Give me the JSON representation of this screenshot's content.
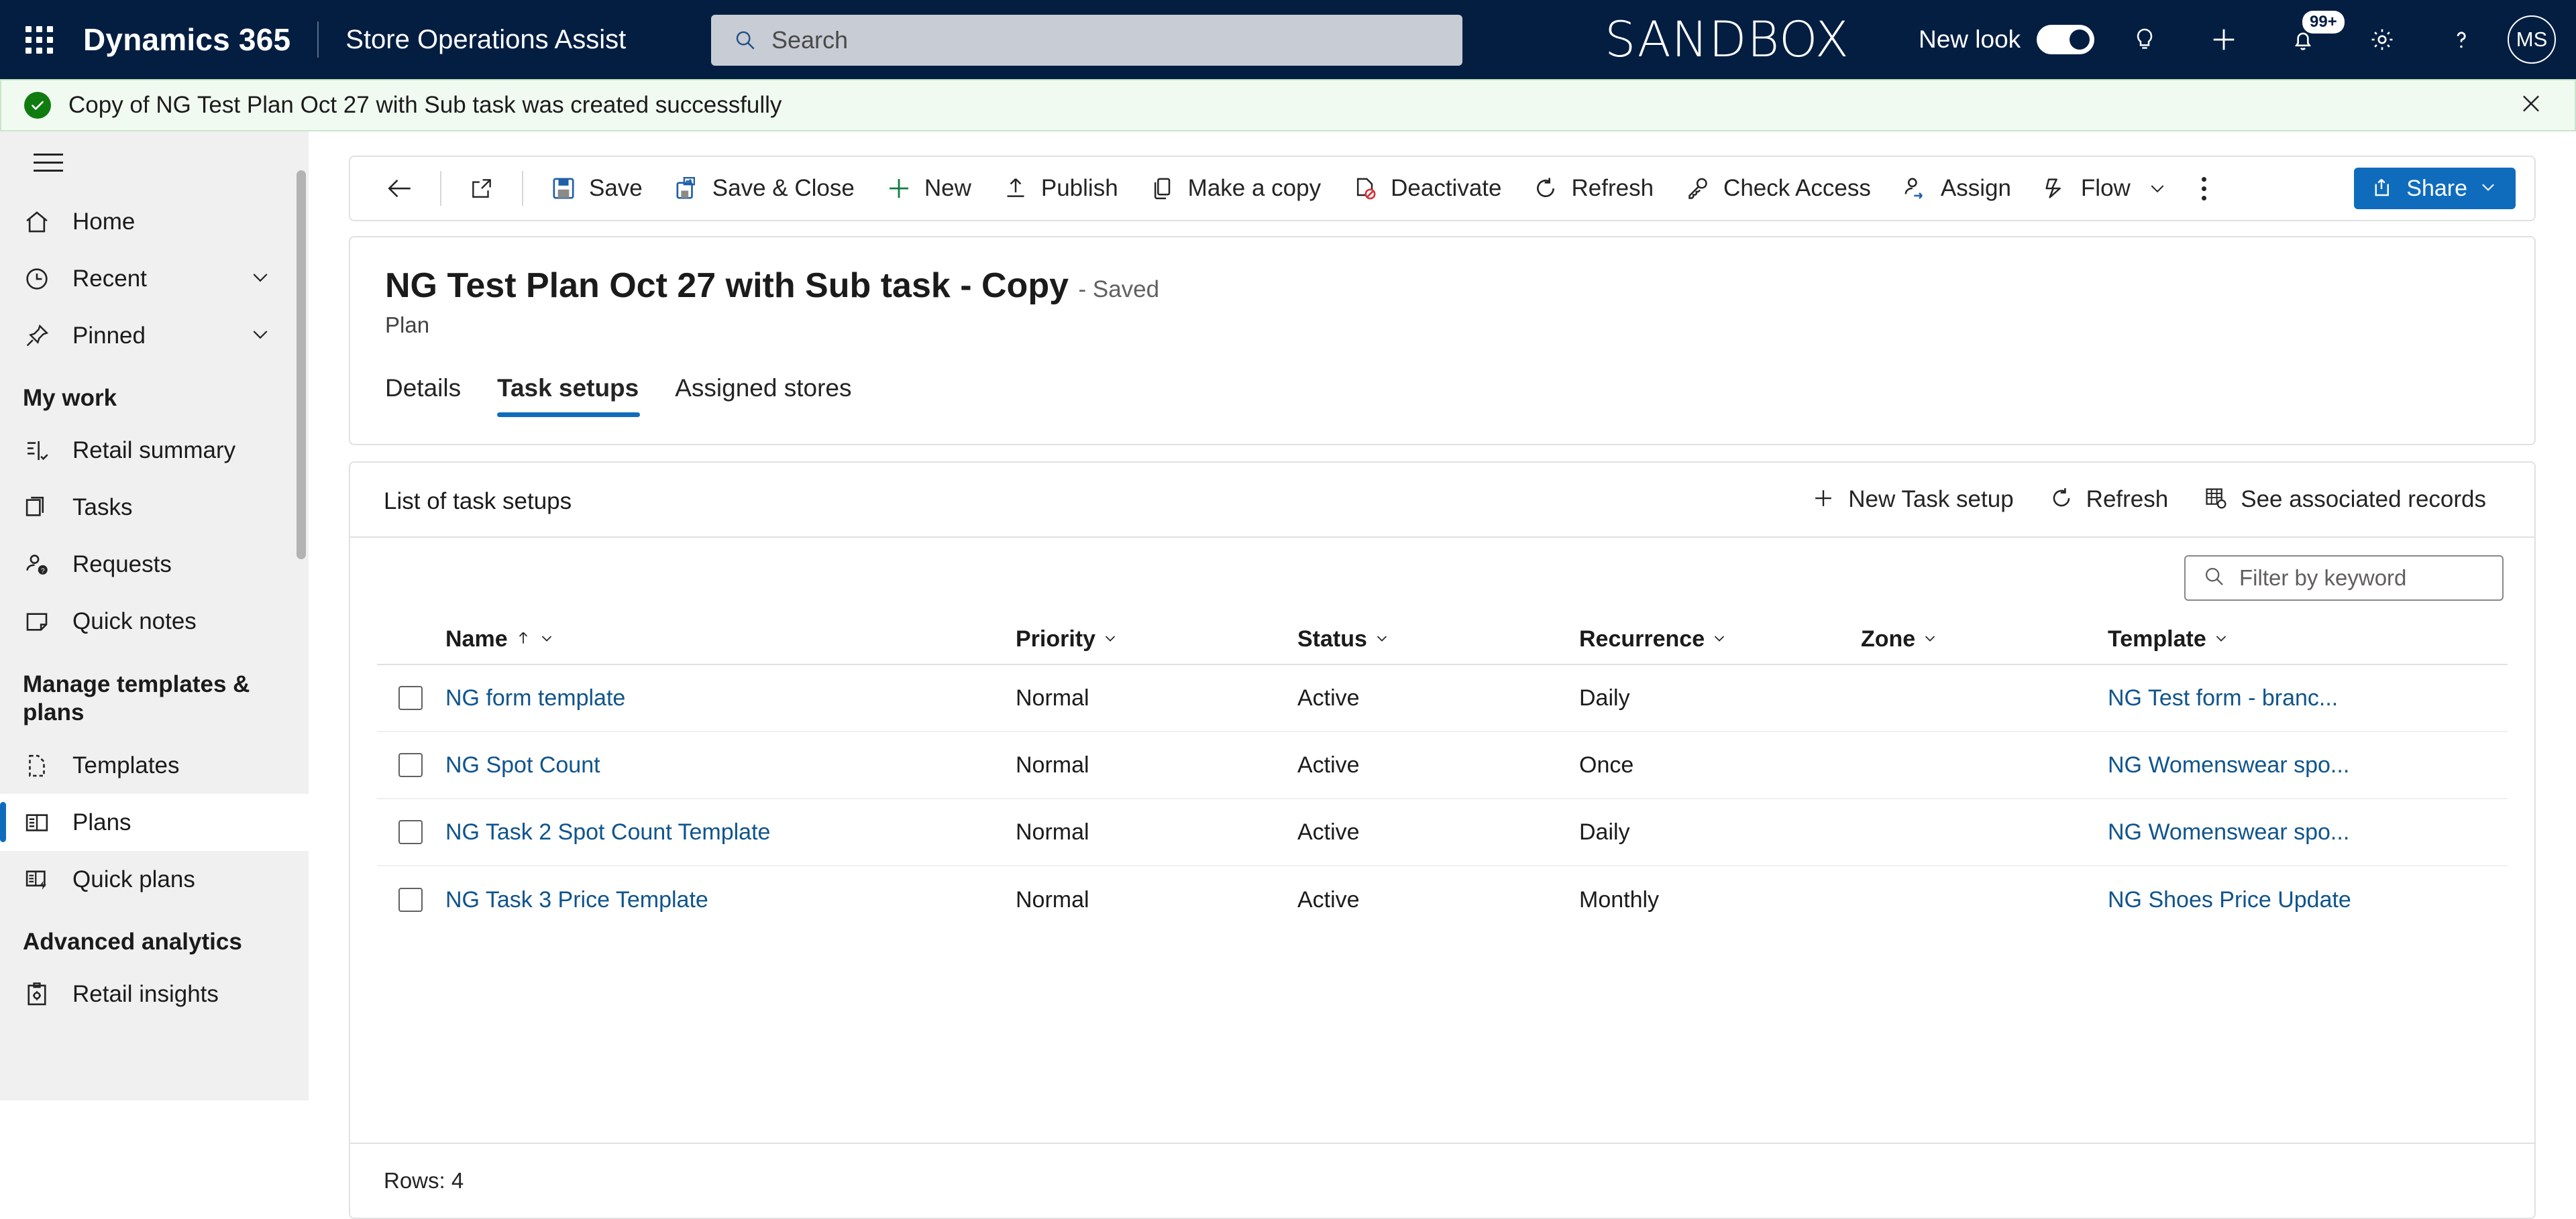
{
  "header": {
    "waffle_label": "app-launcher",
    "brand": "Dynamics 365",
    "app_name": "Store Operations Assist",
    "search_placeholder": "Search",
    "environment": "SANDBOX",
    "new_look_label": "New look",
    "new_look_on": true,
    "notification_badge": "99+",
    "avatar_initials": "MS",
    "icons": [
      "lightbulb-icon",
      "add-icon",
      "notification-bell-icon",
      "gear-icon",
      "help-icon"
    ]
  },
  "notification": {
    "message": "Copy of NG Test Plan Oct 27 with Sub task was created successfully",
    "type": "success",
    "close_label": "Close"
  },
  "sidebar": {
    "items": [
      {
        "label": "Home",
        "icon": "home-icon",
        "expandable": false,
        "selected": false
      },
      {
        "label": "Recent",
        "icon": "clock-icon",
        "expandable": true,
        "selected": false
      },
      {
        "label": "Pinned",
        "icon": "pin-icon",
        "expandable": true,
        "selected": false
      }
    ],
    "groups": [
      {
        "title": "My work",
        "items": [
          {
            "label": "Retail summary",
            "icon": "retail-summary-icon",
            "selected": false
          },
          {
            "label": "Tasks",
            "icon": "tasks-icon",
            "selected": false
          },
          {
            "label": "Requests",
            "icon": "requests-icon",
            "selected": false
          },
          {
            "label": "Quick notes",
            "icon": "quick-notes-icon",
            "selected": false
          }
        ]
      },
      {
        "title": "Manage templates & plans",
        "items": [
          {
            "label": "Templates",
            "icon": "templates-icon",
            "selected": false
          },
          {
            "label": "Plans",
            "icon": "plans-icon",
            "selected": true
          },
          {
            "label": "Quick plans",
            "icon": "quick-plans-icon",
            "selected": false
          }
        ]
      },
      {
        "title": "Advanced analytics",
        "items": [
          {
            "label": "Retail insights",
            "icon": "retail-insights-icon",
            "selected": false
          }
        ]
      }
    ]
  },
  "commandbar": {
    "back_label": "Back",
    "popout_label": "Open in new window",
    "buttons": [
      {
        "label": "Save",
        "icon": "save-icon"
      },
      {
        "label": "Save & Close",
        "icon": "save-and-close-icon"
      },
      {
        "label": "New",
        "icon": "plus-icon"
      },
      {
        "label": "Publish",
        "icon": "publish-icon"
      },
      {
        "label": "Make a copy",
        "icon": "copy-icon"
      },
      {
        "label": "Deactivate",
        "icon": "deactivate-icon"
      },
      {
        "label": "Refresh",
        "icon": "refresh-icon"
      },
      {
        "label": "Check Access",
        "icon": "key-icon"
      },
      {
        "label": "Assign",
        "icon": "assign-user-icon"
      },
      {
        "label": "Flow",
        "icon": "flow-icon",
        "has_chevron": true
      }
    ],
    "overflow_label": "More commands",
    "share": {
      "label": "Share",
      "icon": "share-icon",
      "has_chevron": true,
      "color": "#0f6cbd"
    }
  },
  "record": {
    "title": "NG Test Plan Oct 27 with Sub task - Copy",
    "saved_state": "- Saved",
    "entity": "Plan",
    "tabs": [
      {
        "label": "Details",
        "active": false
      },
      {
        "label": "Task setups",
        "active": true
      },
      {
        "label": "Assigned stores",
        "active": false
      }
    ]
  },
  "grid": {
    "title": "List of task setups",
    "actions": [
      {
        "label": "New Task setup",
        "icon": "plus-icon"
      },
      {
        "label": "Refresh",
        "icon": "refresh-icon"
      },
      {
        "label": "See associated records",
        "icon": "associated-records-icon"
      }
    ],
    "filter_placeholder": "Filter by keyword",
    "columns": [
      {
        "label": "Name",
        "sorted": "asc"
      },
      {
        "label": "Priority",
        "sorted": null
      },
      {
        "label": "Status",
        "sorted": null
      },
      {
        "label": "Recurrence",
        "sorted": null
      },
      {
        "label": "Zone",
        "sorted": null
      },
      {
        "label": "Template",
        "sorted": null
      }
    ],
    "rows": [
      {
        "name": "NG form template",
        "priority": "Normal",
        "status": "Active",
        "recurrence": "Daily",
        "zone": "",
        "template": "NG Test form - branc..."
      },
      {
        "name": "NG Spot Count",
        "priority": "Normal",
        "status": "Active",
        "recurrence": "Once",
        "zone": "",
        "template": "NG Womenswear spo..."
      },
      {
        "name": "NG Task 2 Spot Count Template",
        "priority": "Normal",
        "status": "Active",
        "recurrence": "Daily",
        "zone": "",
        "template": "NG Womenswear spo..."
      },
      {
        "name": "NG Task 3 Price Template",
        "priority": "Normal",
        "status": "Active",
        "recurrence": "Monthly",
        "zone": "",
        "template": "NG Shoes Price Update"
      }
    ],
    "rows_count": "Rows: 4"
  },
  "colors": {
    "header_bg": "#041e42",
    "accent": "#0f6cbd",
    "link": "#0f548c",
    "success": "#107c10",
    "success_bg": "#f1faf1"
  }
}
